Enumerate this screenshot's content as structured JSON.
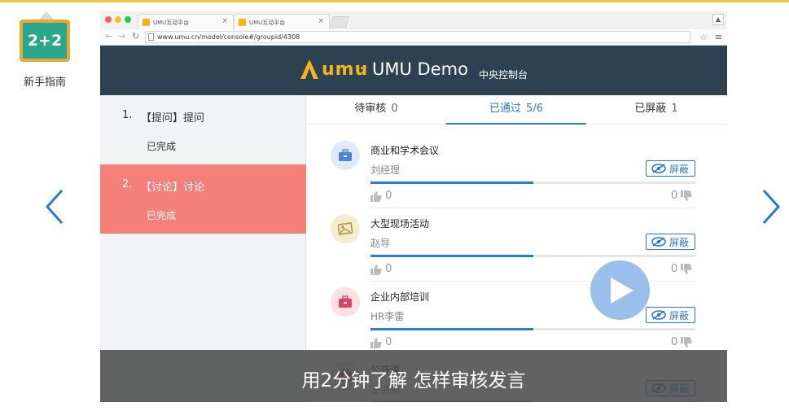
{
  "guide": {
    "badge_text": "2+2",
    "label": "新手指南"
  },
  "browser": {
    "tabs": [
      {
        "title": "UMU互动平台"
      },
      {
        "title": "UMU互动平台"
      }
    ],
    "url": "www.umu.cn/model/console#/groupid/4308"
  },
  "header": {
    "logo_text": "umu",
    "separator": "·",
    "title": "UMU Demo",
    "subtitle": "中央控制台"
  },
  "sidebar": {
    "items": [
      {
        "num": "1.",
        "title": "【提问】提问",
        "status": "已完成",
        "active": false
      },
      {
        "num": "2.",
        "title": "【讨论】讨论",
        "status": "已完成",
        "active": true
      }
    ]
  },
  "tabs": [
    {
      "label": "待审核",
      "count": "0",
      "active": false
    },
    {
      "label": "已通过",
      "count": "5/6",
      "active": true
    },
    {
      "label": "已屏蔽",
      "count": "1",
      "active": false
    }
  ],
  "posts": [
    {
      "title": "商业和学术会议",
      "author": "刘经理",
      "likes": "0",
      "dislikes": "0",
      "progress": 0.5,
      "avatar_color": "#dfe9f8",
      "icon": "briefcase-icon",
      "icon_color": "#4a86d8"
    },
    {
      "title": "大型现场活动",
      "author": "赵导",
      "likes": "0",
      "dislikes": "0",
      "progress": 0.5,
      "avatar_color": "#f3ecd2",
      "icon": "photo-icon",
      "icon_color": "#b8962b"
    },
    {
      "title": "企业内部培训",
      "author": "HR李雷",
      "likes": "0",
      "dislikes": "0",
      "progress": 0.5,
      "avatar_color": "#fbe0e4",
      "icon": "toolbox-icon",
      "icon_color": "#d6446b"
    },
    {
      "title": "公开课",
      "author": "王讲师",
      "likes": "0",
      "dislikes": "0",
      "progress": 0.5,
      "avatar_color": "#fbe0e4",
      "icon": "toolbox-icon",
      "icon_color": "#d6446b"
    }
  ],
  "post_action": {
    "hide_label": "屏蔽"
  },
  "caption": "用2分钟了解 怎样审核发言",
  "colors": {
    "accent": "#2b7ad6",
    "header_bg": "#2d4153",
    "active_item": "#f5807a",
    "brand": "#f5b31c"
  }
}
